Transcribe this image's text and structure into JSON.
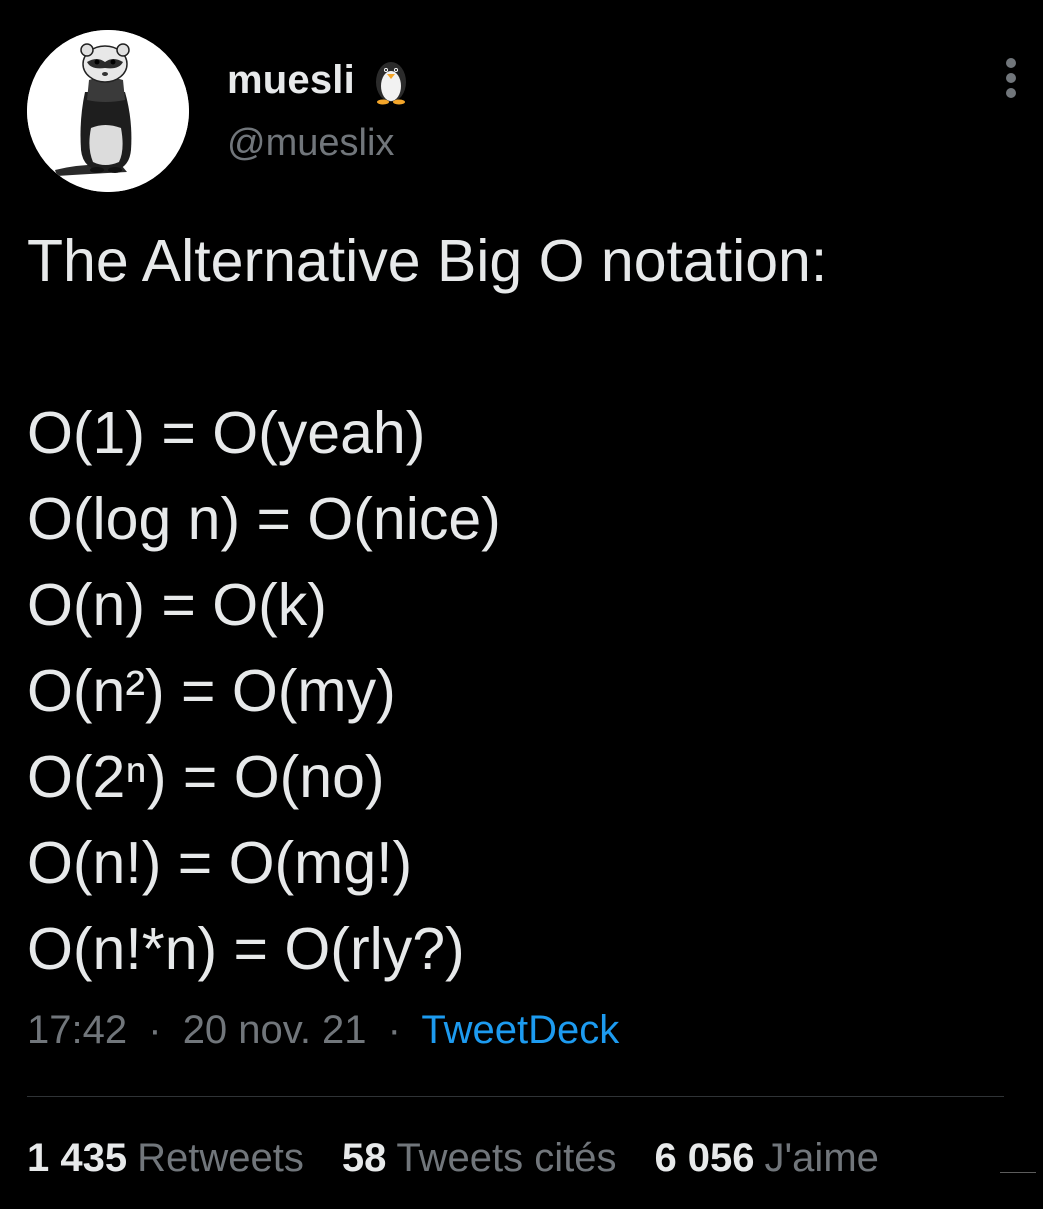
{
  "author": {
    "display_name": "muesli",
    "handle": "@mueslix",
    "avatar_icon": "ferret-avatar",
    "badge_icon": "penguin-emoji-icon"
  },
  "tweet": {
    "lines": [
      "The Alternative Big O notation:",
      "",
      "O(1) = O(yeah)",
      "O(log n) = O(nice)",
      "O(n) = O(k)",
      "O(n²) = O(my)",
      "O(2ⁿ) = O(no)",
      "O(n!) = O(mg!)",
      "O(n!*n) = O(rly?)"
    ]
  },
  "meta": {
    "time": "17:42",
    "separator": "·",
    "date": "20 nov. 21",
    "source": "TweetDeck"
  },
  "stats": {
    "retweets_count": "1 435",
    "retweets_label": "Retweets",
    "quotes_count": "58",
    "quotes_label": "Tweets cités",
    "likes_count": "6 056",
    "likes_label": "J'aime"
  },
  "colors": {
    "background": "#000000",
    "text_primary": "#e7e9ea",
    "text_secondary": "#71767b",
    "link": "#1d9bf0",
    "divider": "#2f3336"
  }
}
